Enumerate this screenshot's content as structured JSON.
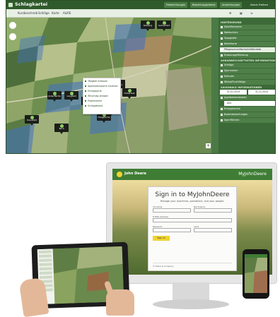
{
  "app": {
    "title": "Schlagkartei",
    "top_buttons": [
      "Feldsichtungen",
      "Bewertungsdienst",
      "Anmerkungen",
      "Alexis Freiherr"
    ],
    "toolbar": [
      "Kurzbeschreib",
      "Schläge",
      "Karte",
      "ALKIS"
    ]
  },
  "sidebar": {
    "sections": [
      {
        "heading": "HINTERGRUND",
        "items": [
          "Satellitenkarte",
          "Waldschutz",
          "Topografie",
          "Reliefkarte",
          "Pflegeschutzfläche/Gefährdete",
          "Erosionsgefährdung"
        ],
        "active_index": 4
      },
      {
        "heading": "AGRARBESCHÄFTIGTEN INFORMATIONEN",
        "items": [
          "Schläge",
          "Sperrzonen",
          "Kulturen",
          "Wiese/Fruchtfolge"
        ],
        "active_index": -1
      },
      {
        "heading": "SAISONALE INFORMATIONEN",
        "dates": [
          "01.01.2019",
          "31.12.2019"
        ],
        "items": [
          "Applikationskarten",
          "Ertragskarten",
          "Bodenbewertungen",
          "Sperrflächen"
        ],
        "select_value": "Alle",
        "active_index": -1
      }
    ]
  },
  "context_menu": {
    "items": [
      "Tätigkeit erfassen",
      "Applikationskarte erstellen",
      "Ertragskarte",
      "Teilschlag anlegen",
      "Probenahme",
      "Schlagdetails"
    ]
  },
  "map_pins": [
    "Ruhberg",
    "Gartenfeld",
    "Ackerfläche",
    "Langfeld",
    "Weide",
    "Oberfeld",
    "Hinterfeld",
    "Hangfläche",
    "Teich",
    "Kreuzfeld",
    "Brunnen"
  ],
  "monitor": {
    "brand": "John Deere",
    "portal": "MyJohnDeere",
    "signin_title": "Sign in to MyJohnDeere",
    "signin_subtitle": "Manage your machines, operations, and your people.",
    "fields": [
      "Vorname",
      "Nachname",
      "E-Mail-Adresse",
      "Passwort",
      "Land"
    ],
    "signin_button": "Sign in",
    "footer": "© Deere & Company"
  },
  "colors": {
    "brand_green": "#367c2b",
    "brand_yellow": "#f1d42e"
  }
}
